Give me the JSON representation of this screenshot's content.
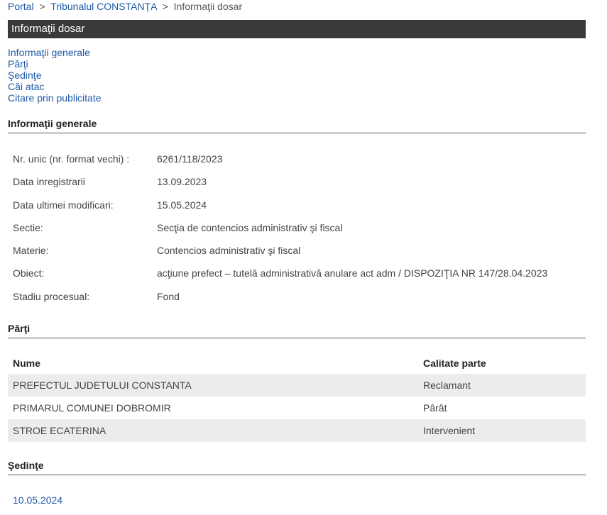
{
  "breadcrumb": {
    "items": [
      "Portal",
      "Tribunalul CONSTANȚA",
      "Informaţii dosar"
    ],
    "separator": ">"
  },
  "page_title": "Informaţii dosar",
  "toc": [
    "Informaţii generale",
    "Părţi",
    "Şedinţe",
    "Căi atac",
    "Citare prin publicitate"
  ],
  "sections": {
    "general": "Informaţii generale",
    "parti": "Părţi",
    "sedinte": "Şedinţe"
  },
  "general_info": [
    {
      "label": "Nr. unic (nr. format vechi) :",
      "value": "6261/118/2023"
    },
    {
      "label": "Data inregistrarii",
      "value": "13.09.2023"
    },
    {
      "label": "Data ultimei modificari:",
      "value": "15.05.2024"
    },
    {
      "label": "Sectie:",
      "value": "Secţia de contencios administrativ şi fiscal"
    },
    {
      "label": "Materie:",
      "value": "Contencios administrativ şi fiscal"
    },
    {
      "label": "Obiect:",
      "value": "acţiune prefect – tutelă administrativă anulare act adm / DISPOZIŢIA NR 147/28.04.2023"
    },
    {
      "label": "Stadiu procesual:",
      "value": "Fond"
    }
  ],
  "parti": {
    "headers": {
      "name": "Nume",
      "calitate": "Calitate parte"
    },
    "rows": [
      {
        "name": "PREFECTUL JUDETULUI CONSTANTA",
        "calitate": "Reclamant"
      },
      {
        "name": "PRIMARUL COMUNEI DOBROMIR",
        "calitate": "Pârât"
      },
      {
        "name": "STROE ECATERINA",
        "calitate": "Intervenient"
      }
    ]
  },
  "sedinte": [
    "10.05.2024"
  ],
  "colors": {
    "title_bar": "#3a3a3a",
    "link": "#1f5aa6",
    "row_shade": "#ececec"
  }
}
